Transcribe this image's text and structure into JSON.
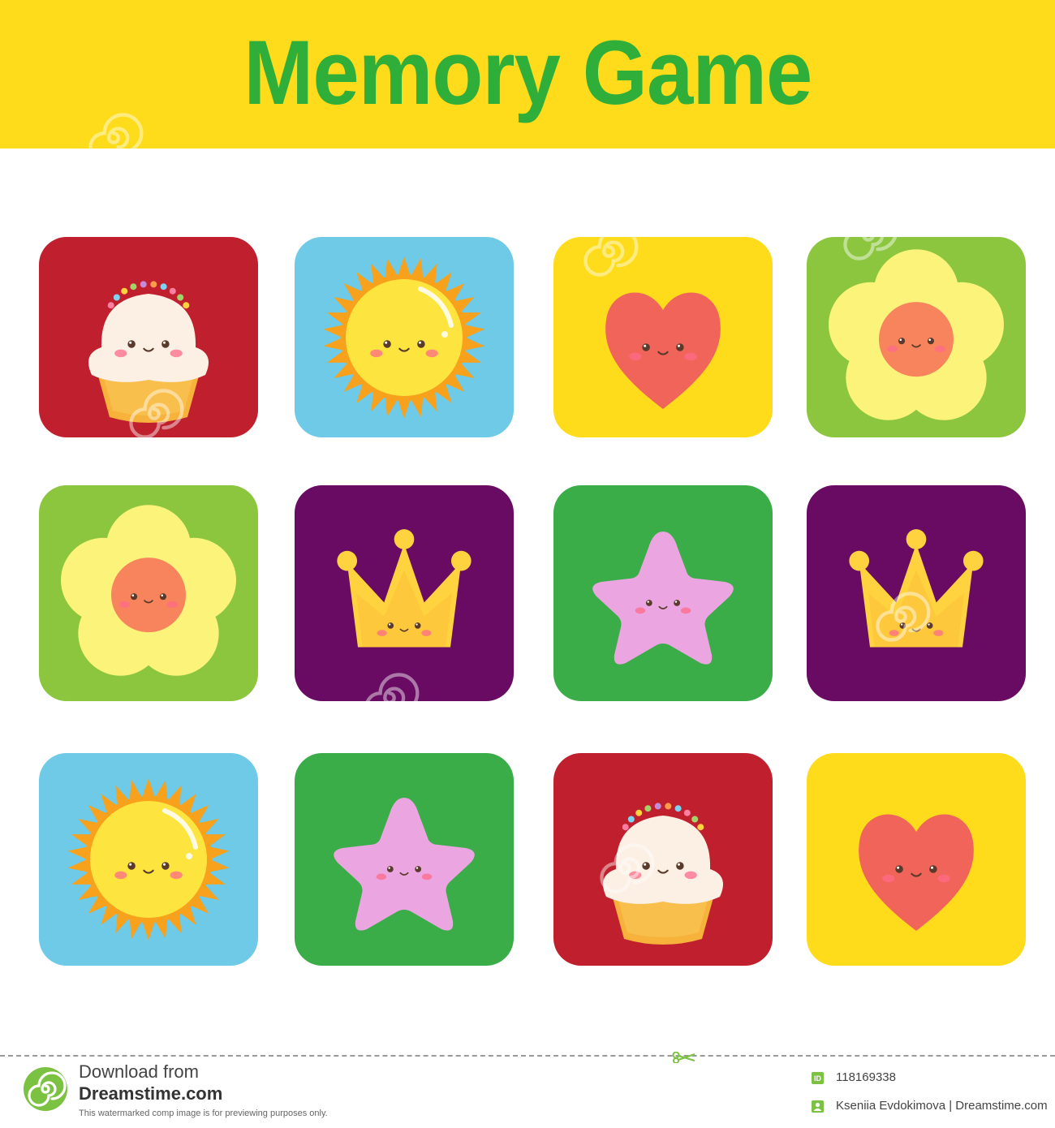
{
  "header": {
    "title": "Memory Game",
    "bg_color": "#ffdc1b",
    "title_color": "#2fae3a"
  },
  "cards": [
    {
      "row": 1,
      "col": 1,
      "symbol": "cupcake",
      "bg": "#c0202e"
    },
    {
      "row": 1,
      "col": 2,
      "symbol": "sun",
      "bg": "#6ecae6"
    },
    {
      "row": 1,
      "col": 3,
      "symbol": "heart",
      "bg": "#ffdc1b"
    },
    {
      "row": 1,
      "col": 4,
      "symbol": "flower",
      "bg": "#8cc63f"
    },
    {
      "row": 2,
      "col": 1,
      "symbol": "flower",
      "bg": "#8cc63f"
    },
    {
      "row": 2,
      "col": 2,
      "symbol": "crown",
      "bg": "#690a63"
    },
    {
      "row": 2,
      "col": 3,
      "symbol": "star",
      "bg": "#3aad49"
    },
    {
      "row": 2,
      "col": 4,
      "symbol": "crown",
      "bg": "#690a63"
    },
    {
      "row": 3,
      "col": 1,
      "symbol": "sun",
      "bg": "#6ecae6"
    },
    {
      "row": 3,
      "col": 2,
      "symbol": "star",
      "bg": "#3aad49"
    },
    {
      "row": 3,
      "col": 3,
      "symbol": "cupcake",
      "bg": "#c0202e"
    },
    {
      "row": 3,
      "col": 4,
      "symbol": "heart",
      "bg": "#ffdc1b"
    }
  ],
  "watermark": {
    "text": "dreamstime"
  },
  "footer": {
    "download_label": "Download from",
    "site_name": "Dreamstime.com",
    "note": "This watermarked comp image is for previewing purposes only.",
    "id_badge": "ID",
    "image_id": "118169338",
    "author": "Kseniia Evdokimova | Dreamstime.com"
  }
}
